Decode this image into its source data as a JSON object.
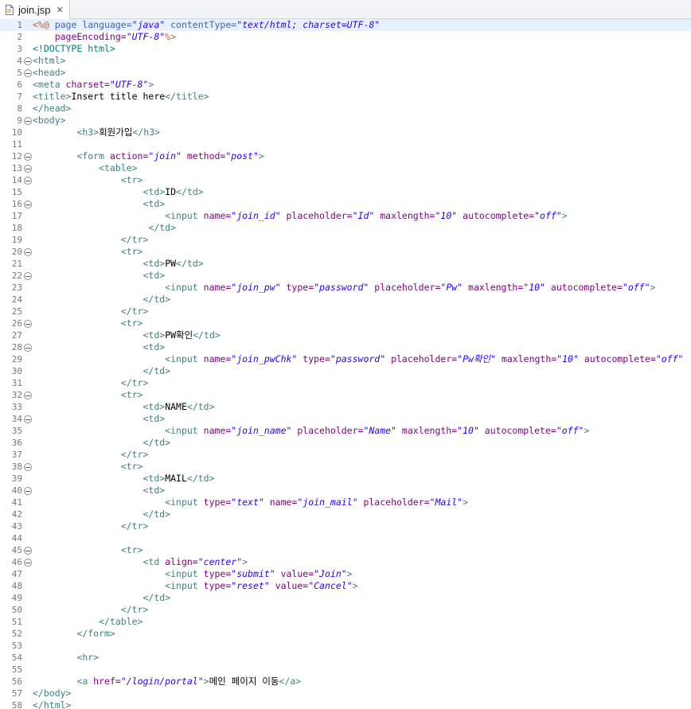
{
  "tab": {
    "file_name": "join.jsp",
    "icon": "jsp-file-icon",
    "close_icon": "close-icon"
  },
  "editor": {
    "active_line": 1,
    "lines": [
      {
        "n": "1",
        "fold": false,
        "tokens": [
          [
            "d",
            "<%@ "
          ],
          [
            "j",
            "page language="
          ],
          [
            "v",
            "\"java\""
          ],
          [
            "j",
            " contentType="
          ],
          [
            "v",
            "\"text/html; charset=UTF-8\""
          ]
        ]
      },
      {
        "n": "2",
        "fold": false,
        "tokens": [
          [
            "a",
            "    pageEncoding="
          ],
          [
            "v",
            "\"UTF-8\""
          ],
          [
            "d",
            "%>"
          ]
        ]
      },
      {
        "n": "3",
        "fold": false,
        "tokens": [
          [
            "doc",
            "<!DOCTYPE html>"
          ]
        ]
      },
      {
        "n": "4",
        "fold": true,
        "tokens": [
          [
            "g",
            "<html>"
          ]
        ]
      },
      {
        "n": "5",
        "fold": true,
        "tokens": [
          [
            "g",
            "<head>"
          ]
        ]
      },
      {
        "n": "6",
        "fold": false,
        "tokens": [
          [
            "g",
            "<meta "
          ],
          [
            "a",
            "charset="
          ],
          [
            "v",
            "\"UTF-8\""
          ],
          [
            "g",
            ">"
          ]
        ]
      },
      {
        "n": "7",
        "fold": false,
        "tokens": [
          [
            "g",
            "<title>"
          ],
          [
            "t",
            "Insert title here"
          ],
          [
            "g",
            "</title>"
          ]
        ]
      },
      {
        "n": "8",
        "fold": false,
        "tokens": [
          [
            "g",
            "</head>"
          ]
        ]
      },
      {
        "n": "9",
        "fold": true,
        "tokens": [
          [
            "g",
            "<body>"
          ]
        ]
      },
      {
        "n": "10",
        "fold": false,
        "tokens": [
          [
            "t",
            "        "
          ],
          [
            "g",
            "<h3>"
          ],
          [
            "t",
            "회원가입"
          ],
          [
            "g",
            "</h3>"
          ]
        ]
      },
      {
        "n": "11",
        "fold": false,
        "tokens": []
      },
      {
        "n": "12",
        "fold": true,
        "tokens": [
          [
            "t",
            "        "
          ],
          [
            "g",
            "<form "
          ],
          [
            "a",
            "action="
          ],
          [
            "v",
            "\"join\""
          ],
          [
            "a",
            " method="
          ],
          [
            "v",
            "\"post\""
          ],
          [
            "g",
            ">"
          ]
        ]
      },
      {
        "n": "13",
        "fold": true,
        "tokens": [
          [
            "t",
            "            "
          ],
          [
            "g",
            "<table>"
          ]
        ]
      },
      {
        "n": "14",
        "fold": true,
        "tokens": [
          [
            "t",
            "                "
          ],
          [
            "g",
            "<tr>"
          ]
        ]
      },
      {
        "n": "15",
        "fold": false,
        "tokens": [
          [
            "t",
            "                    "
          ],
          [
            "g",
            "<td>"
          ],
          [
            "t",
            "ID"
          ],
          [
            "g",
            "</td>"
          ]
        ]
      },
      {
        "n": "16",
        "fold": true,
        "tokens": [
          [
            "t",
            "                    "
          ],
          [
            "g",
            "<td>"
          ]
        ]
      },
      {
        "n": "17",
        "fold": false,
        "tokens": [
          [
            "t",
            "                        "
          ],
          [
            "g",
            "<input "
          ],
          [
            "a",
            "name="
          ],
          [
            "v",
            "\"join_id\""
          ],
          [
            "a",
            " placeholder="
          ],
          [
            "v",
            "\"Id\""
          ],
          [
            "a",
            " maxlength="
          ],
          [
            "v",
            "\"10\""
          ],
          [
            "a",
            " autocomplete="
          ],
          [
            "v",
            "\"off\""
          ],
          [
            "g",
            ">"
          ]
        ]
      },
      {
        "n": "18",
        "fold": false,
        "tokens": [
          [
            "t",
            "                     "
          ],
          [
            "g",
            "</td>"
          ]
        ]
      },
      {
        "n": "19",
        "fold": false,
        "tokens": [
          [
            "t",
            "                "
          ],
          [
            "g",
            "</tr>"
          ]
        ]
      },
      {
        "n": "20",
        "fold": true,
        "tokens": [
          [
            "t",
            "                "
          ],
          [
            "g",
            "<tr>"
          ]
        ]
      },
      {
        "n": "21",
        "fold": false,
        "tokens": [
          [
            "t",
            "                    "
          ],
          [
            "g",
            "<td>"
          ],
          [
            "t",
            "PW"
          ],
          [
            "g",
            "</td>"
          ]
        ]
      },
      {
        "n": "22",
        "fold": true,
        "tokens": [
          [
            "t",
            "                    "
          ],
          [
            "g",
            "<td>"
          ]
        ]
      },
      {
        "n": "23",
        "fold": false,
        "tokens": [
          [
            "t",
            "                        "
          ],
          [
            "g",
            "<input "
          ],
          [
            "a",
            "name="
          ],
          [
            "v",
            "\"join_pw\""
          ],
          [
            "a",
            " type="
          ],
          [
            "v",
            "\"password\""
          ],
          [
            "a",
            " placeholder="
          ],
          [
            "v",
            "\"Pw\""
          ],
          [
            "a",
            " maxlength="
          ],
          [
            "v",
            "\"10\""
          ],
          [
            "a",
            " autocomplete="
          ],
          [
            "v",
            "\"off\""
          ],
          [
            "g",
            ">"
          ]
        ]
      },
      {
        "n": "24",
        "fold": false,
        "tokens": [
          [
            "t",
            "                    "
          ],
          [
            "g",
            "</td>"
          ]
        ]
      },
      {
        "n": "25",
        "fold": false,
        "tokens": [
          [
            "t",
            "                "
          ],
          [
            "g",
            "</tr>"
          ]
        ]
      },
      {
        "n": "26",
        "fold": true,
        "tokens": [
          [
            "t",
            "                "
          ],
          [
            "g",
            "<tr>"
          ]
        ]
      },
      {
        "n": "27",
        "fold": false,
        "tokens": [
          [
            "t",
            "                    "
          ],
          [
            "g",
            "<td>"
          ],
          [
            "t",
            "PW확인"
          ],
          [
            "g",
            "</td>"
          ]
        ]
      },
      {
        "n": "28",
        "fold": true,
        "tokens": [
          [
            "t",
            "                    "
          ],
          [
            "g",
            "<td>"
          ]
        ]
      },
      {
        "n": "29",
        "fold": false,
        "tokens": [
          [
            "t",
            "                        "
          ],
          [
            "g",
            "<input "
          ],
          [
            "a",
            "name="
          ],
          [
            "v",
            "\"join_pwChk\""
          ],
          [
            "a",
            " type="
          ],
          [
            "v",
            "\"password\""
          ],
          [
            "a",
            " placeholder="
          ],
          [
            "v",
            "\"Pw확인\""
          ],
          [
            "a",
            " maxlength="
          ],
          [
            "v",
            "\"10\""
          ],
          [
            "a",
            " autocomplete="
          ],
          [
            "v",
            "\"off\""
          ]
        ]
      },
      {
        "n": "30",
        "fold": false,
        "tokens": [
          [
            "t",
            "                    "
          ],
          [
            "g",
            "</td>"
          ]
        ]
      },
      {
        "n": "31",
        "fold": false,
        "tokens": [
          [
            "t",
            "                "
          ],
          [
            "g",
            "</tr>"
          ]
        ]
      },
      {
        "n": "32",
        "fold": true,
        "tokens": [
          [
            "t",
            "                "
          ],
          [
            "g",
            "<tr>"
          ]
        ]
      },
      {
        "n": "33",
        "fold": false,
        "tokens": [
          [
            "t",
            "                    "
          ],
          [
            "g",
            "<td>"
          ],
          [
            "t",
            "NAME"
          ],
          [
            "g",
            "</td>"
          ]
        ]
      },
      {
        "n": "34",
        "fold": true,
        "tokens": [
          [
            "t",
            "                    "
          ],
          [
            "g",
            "<td>"
          ]
        ]
      },
      {
        "n": "35",
        "fold": false,
        "tokens": [
          [
            "t",
            "                        "
          ],
          [
            "g",
            "<input "
          ],
          [
            "a",
            "name="
          ],
          [
            "v",
            "\"join_name\""
          ],
          [
            "a",
            " placeholder="
          ],
          [
            "v",
            "\"Name\""
          ],
          [
            "a",
            " maxlength="
          ],
          [
            "v",
            "\"10\""
          ],
          [
            "a",
            " autocomplete="
          ],
          [
            "v",
            "\"off\""
          ],
          [
            "g",
            ">"
          ]
        ]
      },
      {
        "n": "36",
        "fold": false,
        "tokens": [
          [
            "t",
            "                    "
          ],
          [
            "g",
            "</td>"
          ]
        ]
      },
      {
        "n": "37",
        "fold": false,
        "tokens": [
          [
            "t",
            "                "
          ],
          [
            "g",
            "</tr>"
          ]
        ]
      },
      {
        "n": "38",
        "fold": true,
        "tokens": [
          [
            "t",
            "                "
          ],
          [
            "g",
            "<tr>"
          ]
        ]
      },
      {
        "n": "39",
        "fold": false,
        "tokens": [
          [
            "t",
            "                    "
          ],
          [
            "g",
            "<td>"
          ],
          [
            "t",
            "MAIL"
          ],
          [
            "g",
            "</td>"
          ]
        ]
      },
      {
        "n": "40",
        "fold": true,
        "tokens": [
          [
            "t",
            "                    "
          ],
          [
            "g",
            "<td>"
          ]
        ]
      },
      {
        "n": "41",
        "fold": false,
        "tokens": [
          [
            "t",
            "                        "
          ],
          [
            "g",
            "<input "
          ],
          [
            "a",
            "type="
          ],
          [
            "v",
            "\"text\""
          ],
          [
            "a",
            " name="
          ],
          [
            "v",
            "\"join_mail\""
          ],
          [
            "a",
            " placeholder="
          ],
          [
            "v",
            "\"Mail\""
          ],
          [
            "g",
            ">"
          ]
        ]
      },
      {
        "n": "42",
        "fold": false,
        "tokens": [
          [
            "t",
            "                    "
          ],
          [
            "g",
            "</td>"
          ]
        ]
      },
      {
        "n": "43",
        "fold": false,
        "tokens": [
          [
            "t",
            "                "
          ],
          [
            "g",
            "</tr>"
          ]
        ]
      },
      {
        "n": "44",
        "fold": false,
        "tokens": []
      },
      {
        "n": "45",
        "fold": true,
        "tokens": [
          [
            "t",
            "                "
          ],
          [
            "g",
            "<tr>"
          ]
        ]
      },
      {
        "n": "46",
        "fold": true,
        "tokens": [
          [
            "t",
            "                    "
          ],
          [
            "g",
            "<td "
          ],
          [
            "a",
            "align="
          ],
          [
            "v",
            "\"center\""
          ],
          [
            "g",
            ">"
          ]
        ]
      },
      {
        "n": "47",
        "fold": false,
        "tokens": [
          [
            "t",
            "                        "
          ],
          [
            "g",
            "<input "
          ],
          [
            "a",
            "type="
          ],
          [
            "v",
            "\"submit\""
          ],
          [
            "a",
            " value="
          ],
          [
            "v",
            "\"Join\""
          ],
          [
            "g",
            ">"
          ]
        ]
      },
      {
        "n": "48",
        "fold": false,
        "tokens": [
          [
            "t",
            "                        "
          ],
          [
            "g",
            "<input "
          ],
          [
            "a",
            "type="
          ],
          [
            "v",
            "\"reset\""
          ],
          [
            "a",
            " value="
          ],
          [
            "v",
            "\"Cancel\""
          ],
          [
            "g",
            ">"
          ]
        ]
      },
      {
        "n": "49",
        "fold": false,
        "tokens": [
          [
            "t",
            "                    "
          ],
          [
            "g",
            "</td>"
          ]
        ]
      },
      {
        "n": "50",
        "fold": false,
        "tokens": [
          [
            "t",
            "                "
          ],
          [
            "g",
            "</tr>"
          ]
        ]
      },
      {
        "n": "51",
        "fold": false,
        "tokens": [
          [
            "t",
            "            "
          ],
          [
            "g",
            "</table>"
          ]
        ]
      },
      {
        "n": "52",
        "fold": false,
        "tokens": [
          [
            "t",
            "        "
          ],
          [
            "g",
            "</form>"
          ]
        ]
      },
      {
        "n": "53",
        "fold": false,
        "tokens": []
      },
      {
        "n": "54",
        "fold": false,
        "tokens": [
          [
            "t",
            "        "
          ],
          [
            "g",
            "<hr>"
          ]
        ]
      },
      {
        "n": "55",
        "fold": false,
        "tokens": []
      },
      {
        "n": "56",
        "fold": false,
        "tokens": [
          [
            "t",
            "        "
          ],
          [
            "g",
            "<a "
          ],
          [
            "a",
            "href="
          ],
          [
            "v",
            "\"/login/portal\""
          ],
          [
            "g",
            ">"
          ],
          [
            "t",
            "메인 페이지 이동"
          ],
          [
            "g",
            "</a>"
          ]
        ]
      },
      {
        "n": "57",
        "fold": false,
        "tokens": [
          [
            "g",
            "</body>"
          ]
        ]
      },
      {
        "n": "58",
        "fold": false,
        "tokens": [
          [
            "g",
            "</html>"
          ]
        ]
      }
    ]
  },
  "colors": {
    "tag": "#3f7f7f",
    "attribute": "#7f007f",
    "value": "#2a00ff",
    "directive": "#bf5f3f",
    "line_number": "#787878",
    "current_line": "#e8f2fe"
  }
}
